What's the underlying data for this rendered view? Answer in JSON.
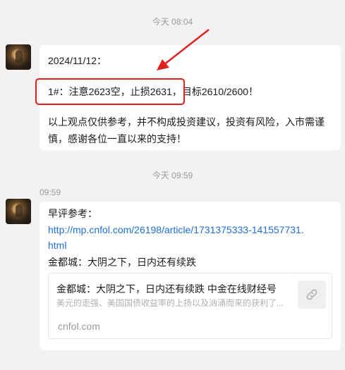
{
  "timestamps": {
    "first": "今天 08:04",
    "second": "今天 09:59"
  },
  "message1": {
    "date_line": "2024/11/12：",
    "signal_line": "1#：注意2623空，止损2631，目标2610/2600！",
    "disclaimer_line1": "以上观点仅供参考，并不构成投资建议，投资有风险，入市需谨",
    "disclaimer_line2": "慎，感谢各位一直以来的支持！"
  },
  "message2": {
    "sender_time": "09:59",
    "intro": "早评参考：",
    "link_line1": "http://mp.cnfol.com/26198/article/1731375333-141557731.",
    "link_line2": "html",
    "headline": "金都城：大阴之下，日内还有续跌",
    "card": {
      "title": "金都城：大阴之下，日内还有续跌 中金在线财经号",
      "description": "美元的走强、美国国债收益率的上扬以及汹涌而来的获利了...",
      "source": "cnfol.com",
      "icon": "link-icon"
    }
  },
  "colors": {
    "annotation_box": "#e02020",
    "annotation_arrow": "#e02020",
    "link": "#1e6fd6"
  }
}
